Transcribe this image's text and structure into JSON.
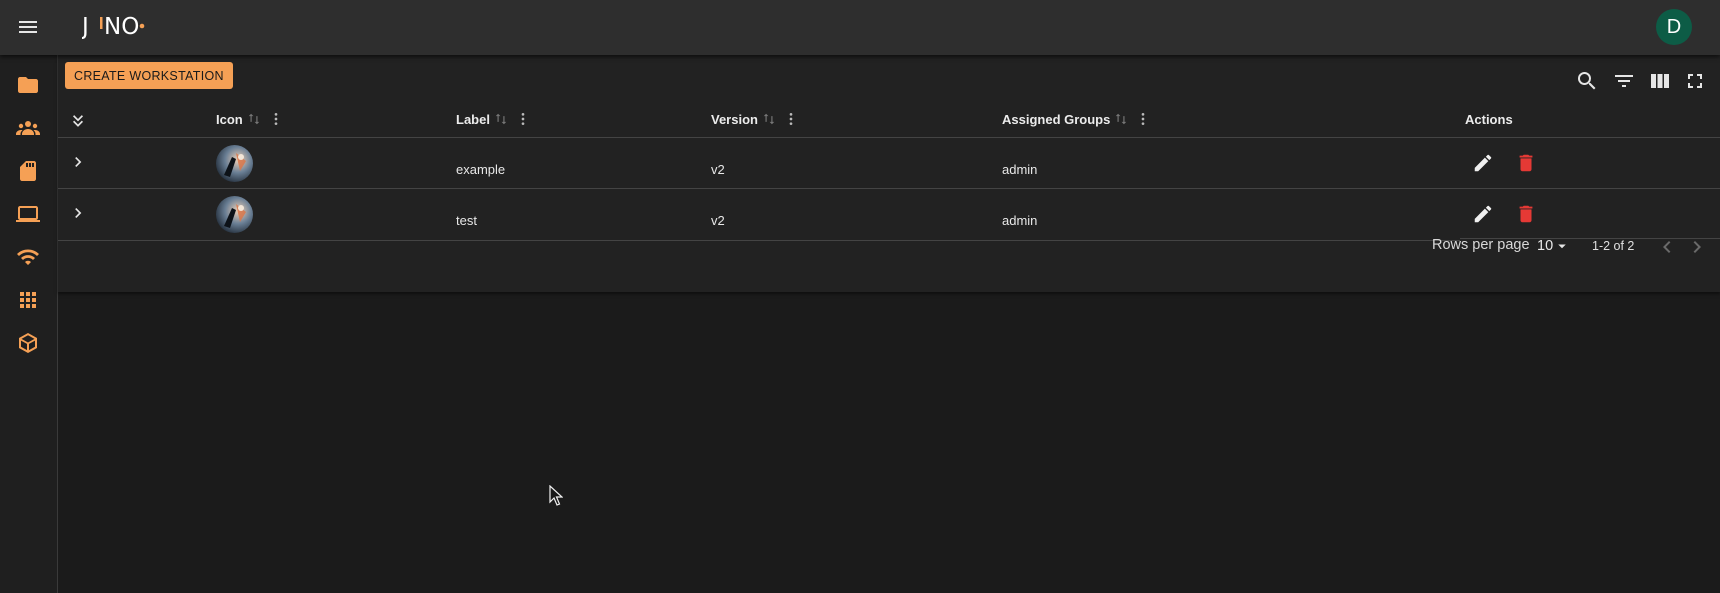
{
  "app": {
    "logo_text": "JUNO",
    "user_initial": "D",
    "accent_color": "#f5a055",
    "avatar_color": "#0d5c46",
    "delete_color": "#e53935"
  },
  "sidebar": {
    "items": [
      {
        "icon": "folder-icon"
      },
      {
        "icon": "groups-icon"
      },
      {
        "icon": "sd-card-icon"
      },
      {
        "icon": "laptop-icon"
      },
      {
        "icon": "wifi-icon"
      },
      {
        "icon": "apps-grid-icon"
      },
      {
        "icon": "package-icon"
      }
    ]
  },
  "toolbar": {
    "create_label": "CREATE WORKSTATION",
    "tools": [
      "search-icon",
      "filter-icon",
      "columns-icon",
      "fullscreen-icon"
    ]
  },
  "table": {
    "columns": {
      "icon": "Icon",
      "label": "Label",
      "version": "Version",
      "groups": "Assigned Groups",
      "actions": "Actions"
    },
    "rows": [
      {
        "label": "example",
        "version": "v2",
        "groups": "admin"
      },
      {
        "label": "test",
        "version": "v2",
        "groups": "admin"
      }
    ]
  },
  "pagination": {
    "rows_per_page_label": "Rows per page",
    "rows_per_page_value": "10",
    "range": "1-2 of 2"
  }
}
